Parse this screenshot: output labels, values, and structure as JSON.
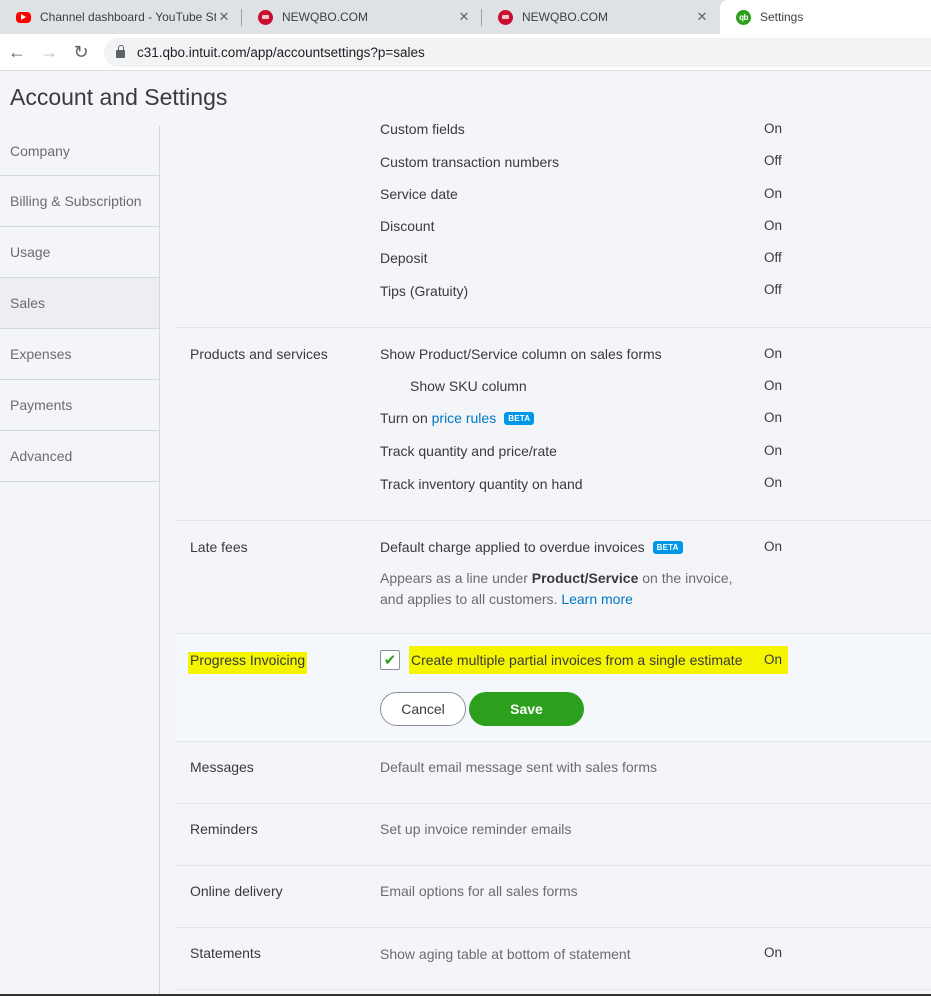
{
  "browser": {
    "tabs": [
      {
        "title": "Channel dashboard - YouTube St",
        "icon": "youtube-icon",
        "active": false
      },
      {
        "title": "NEWQBO.COM",
        "icon": "newqbo-icon",
        "active": false
      },
      {
        "title": "NEWQBO.COM",
        "icon": "newqbo-icon",
        "active": false
      },
      {
        "title": "Settings",
        "icon": "quickbooks-icon",
        "active": true
      }
    ],
    "close_glyph": "✕",
    "nav": {
      "back": "←",
      "forward": "→",
      "reload": "↻"
    },
    "url": "c31.qbo.intuit.com/app/accountsettings?p=sales"
  },
  "page": {
    "title": "Account and Settings"
  },
  "sidebar": {
    "items": [
      {
        "label": "Company"
      },
      {
        "label": "Billing & Subscription"
      },
      {
        "label": "Usage"
      },
      {
        "label": "Sales",
        "active": true
      },
      {
        "label": "Expenses"
      },
      {
        "label": "Payments"
      },
      {
        "label": "Advanced"
      }
    ]
  },
  "sections": {
    "sales_form_content": {
      "rows": [
        {
          "label": "Custom fields",
          "value": "On"
        },
        {
          "label": "Custom transaction numbers",
          "value": "Off"
        },
        {
          "label": "Service date",
          "value": "On"
        },
        {
          "label": "Discount",
          "value": "On"
        },
        {
          "label": "Deposit",
          "value": "Off"
        },
        {
          "label": "Tips (Gratuity)",
          "value": "Off"
        }
      ]
    },
    "products_services": {
      "title": "Products and services",
      "rows": [
        {
          "label": "Show Product/Service column on sales forms",
          "value": "On"
        },
        {
          "label": "Show SKU column",
          "value": "On"
        },
        {
          "label_prefix": "Turn on ",
          "link": "price rules",
          "badge": "BETA",
          "value": "On"
        },
        {
          "label": "Track quantity and price/rate",
          "value": "On"
        },
        {
          "label": "Track inventory quantity on hand",
          "value": "On"
        }
      ]
    },
    "late_fees": {
      "title": "Late fees",
      "label": "Default charge applied to overdue invoices",
      "badge": "BETA",
      "value": "On",
      "desc_part1": "Appears as a line under ",
      "desc_bold": "Product/Service",
      "desc_part2": " on the invoice, and applies to all customers. ",
      "desc_link": "Learn more"
    },
    "progress_invoicing": {
      "title": "Progress Invoicing",
      "checkbox_label": "Create multiple partial invoices from a single estimate",
      "checked": true,
      "check_glyph": "✔",
      "value": "On",
      "cancel_label": "Cancel",
      "save_label": "Save",
      "highlight_color": "#f5f500"
    },
    "messages": {
      "title": "Messages",
      "desc": "Default email message sent with sales forms"
    },
    "reminders": {
      "title": "Reminders",
      "desc": "Set up invoice reminder emails"
    },
    "online_delivery": {
      "title": "Online delivery",
      "desc": "Email options for all sales forms"
    },
    "statements": {
      "title": "Statements",
      "desc": "Show aging table at bottom of statement",
      "value": "On"
    }
  },
  "colors": {
    "brand_green": "#2ca01c",
    "link_blue": "#0077c5",
    "beta_blue": "#0097e6"
  }
}
